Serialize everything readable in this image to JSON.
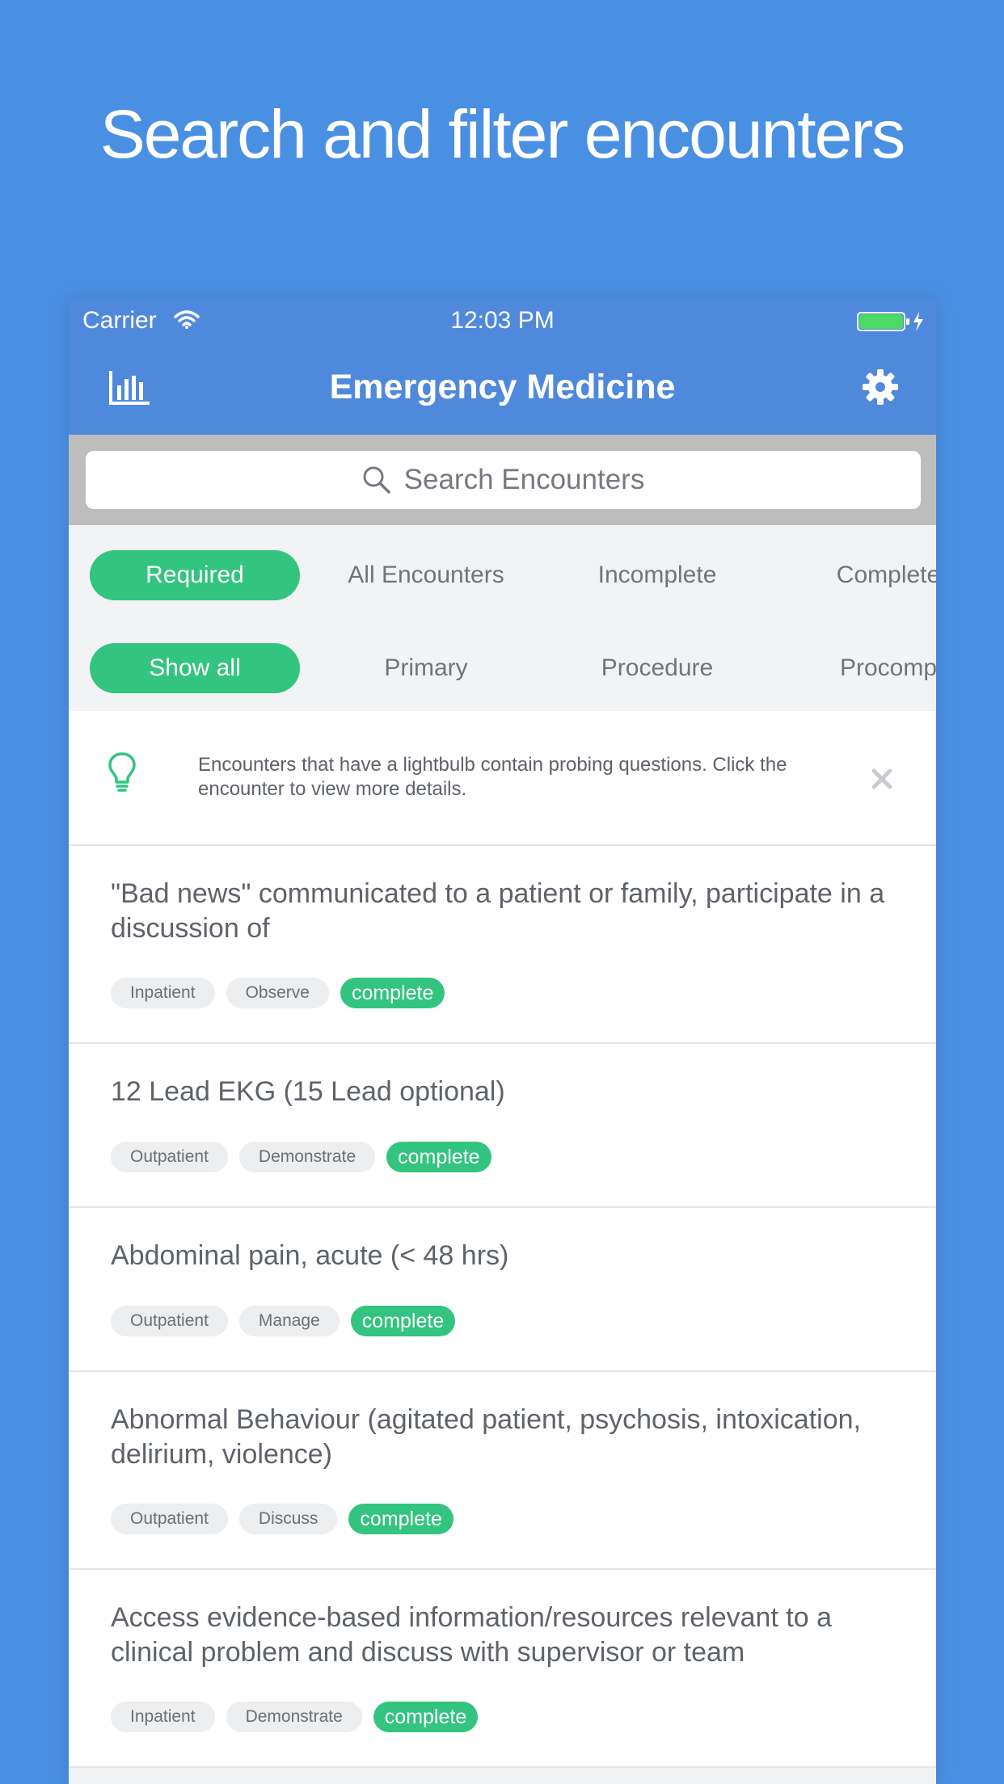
{
  "headline": "Search and filter encounters",
  "status_bar": {
    "carrier": "Carrier",
    "time": "12:03 PM"
  },
  "nav": {
    "title": "Emergency Medicine"
  },
  "search": {
    "placeholder": "Search Encounters"
  },
  "filters": {
    "status_options": [
      "Required",
      "All Encounters",
      "Incomplete",
      "Complete"
    ],
    "type_options": [
      "Show all",
      "Primary",
      "Procedure",
      "Procomp"
    ]
  },
  "tip": {
    "text": "Encounters that have a lightbulb contain probing questions. Click the encounter to view more details."
  },
  "encounters": [
    {
      "title": "\"Bad news\" communicated to a patient or family, participate in a discussion of",
      "setting": "Inpatient",
      "level": "Observe",
      "status": "complete"
    },
    {
      "title": "12 Lead EKG (15 Lead optional)",
      "setting": "Outpatient",
      "level": "Demonstrate",
      "status": "complete"
    },
    {
      "title": "Abdominal pain, acute (< 48 hrs)",
      "setting": "Outpatient",
      "level": "Manage",
      "status": "complete"
    },
    {
      "title": "Abnormal Behaviour (agitated patient, psychosis, intoxication, delirium, violence)",
      "setting": "Outpatient",
      "level": "Discuss",
      "status": "complete"
    },
    {
      "title": "Access evidence-based information/resources relevant to a clinical problem and discuss with supervisor or team",
      "setting": "Inpatient",
      "level": "Demonstrate",
      "status": "complete"
    }
  ],
  "colors": {
    "background": "#4a90e2",
    "nav": "#4f89dc",
    "accent_green": "#33c47f"
  }
}
